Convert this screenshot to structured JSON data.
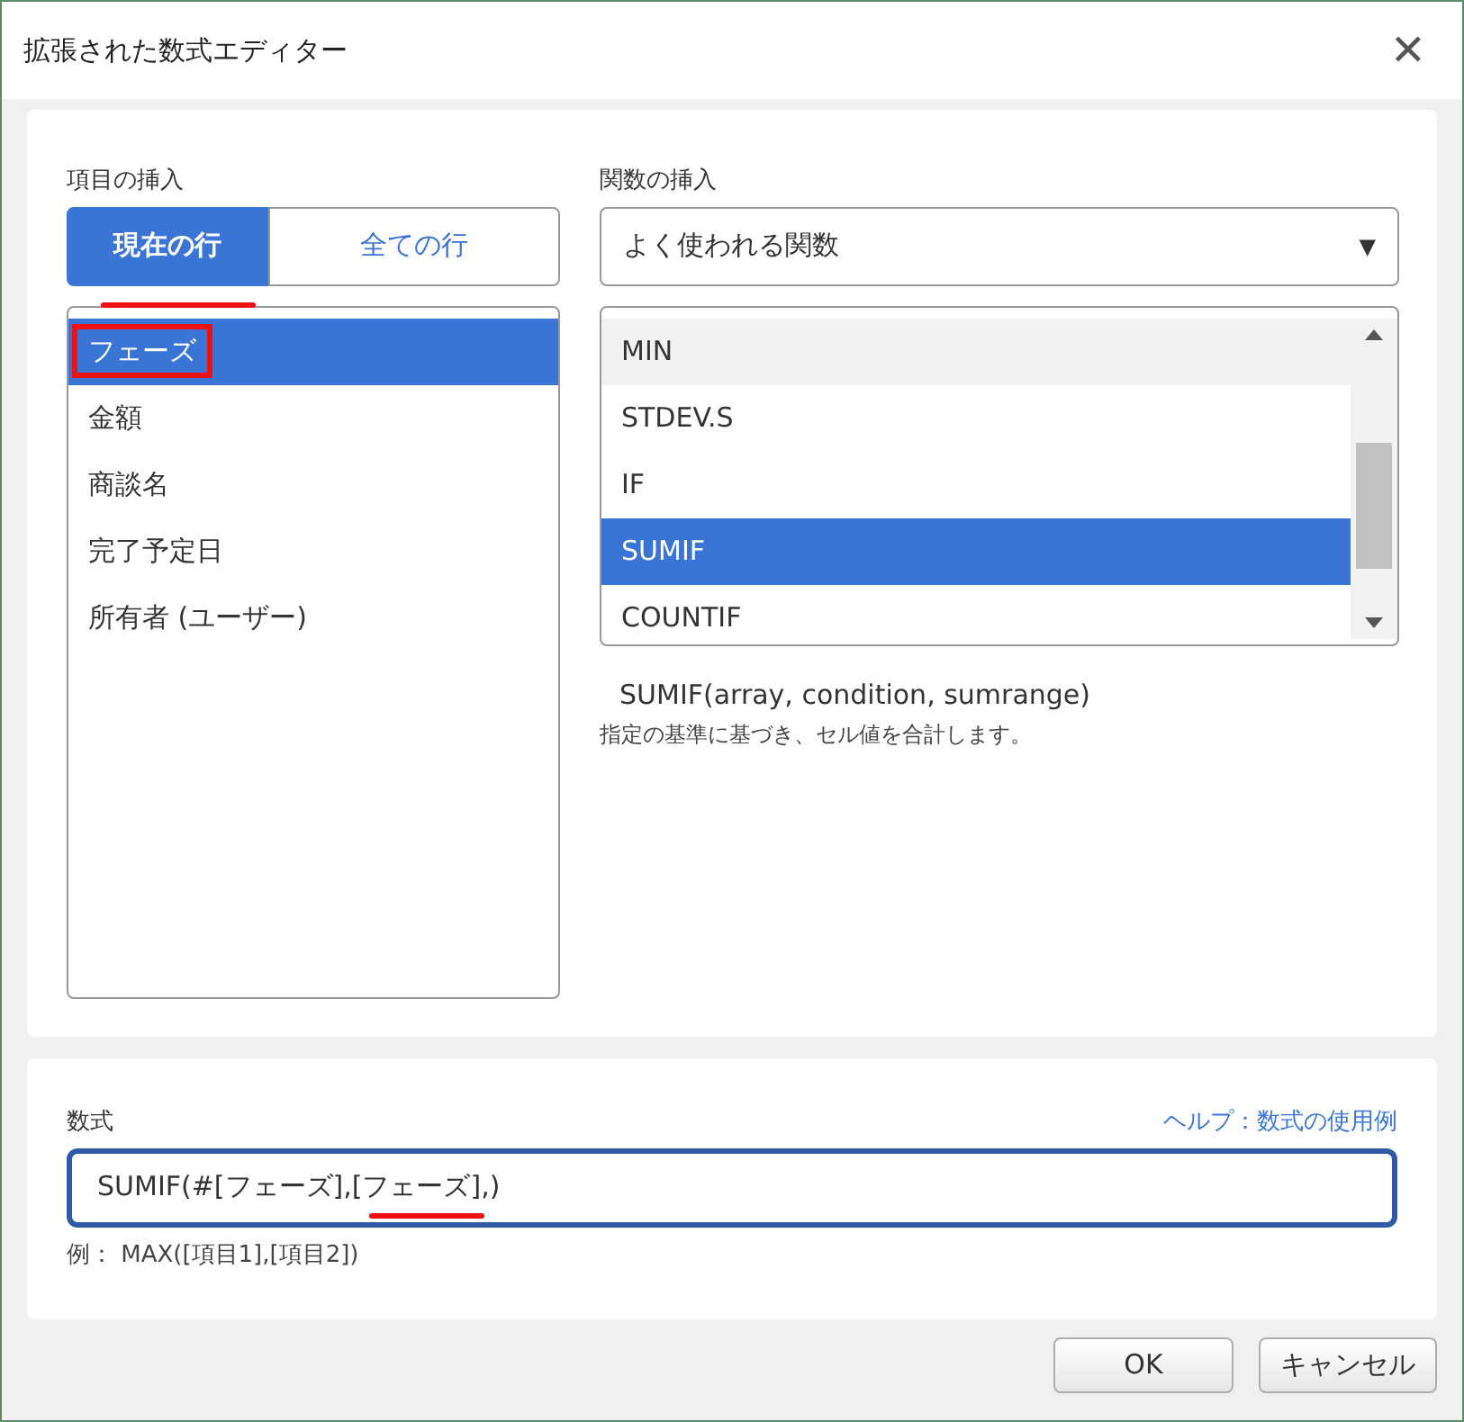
{
  "window": {
    "title": "拡張された数式エディター",
    "close": "✕"
  },
  "fields_section": {
    "label": "項目の挿入",
    "tabs": [
      {
        "label": "現在の行",
        "selected": true,
        "annotated": true
      },
      {
        "label": "全ての行",
        "selected": false,
        "annotated": false
      }
    ],
    "items": [
      {
        "label": "フェーズ",
        "selected": true,
        "annotated": true
      },
      {
        "label": "金額",
        "selected": false,
        "annotated": false
      },
      {
        "label": "商談名",
        "selected": false,
        "annotated": false
      },
      {
        "label": "完了予定日",
        "selected": false,
        "annotated": false
      },
      {
        "label": "所有者 (ユーザー)",
        "selected": false,
        "annotated": false
      }
    ]
  },
  "functions_section": {
    "label": "関数の挿入",
    "dropdown": {
      "value": "よく使われる関数",
      "arrow": "▼"
    },
    "items": [
      {
        "label": "MIN",
        "selected": false,
        "hovered": true
      },
      {
        "label": "STDEV.S",
        "selected": false,
        "hovered": false
      },
      {
        "label": "IF",
        "selected": false,
        "hovered": false
      },
      {
        "label": "SUMIF",
        "selected": true,
        "hovered": false
      },
      {
        "label": "COUNTIF",
        "selected": false,
        "hovered": false
      }
    ],
    "signature": "SUMIF(array, condition, sumrange)",
    "description": "指定の基準に基づき、セル値を合計します。"
  },
  "formula": {
    "label": "数式",
    "help_link": "ヘルプ：数式の使用例",
    "value": "SUMIF(#[フェーズ],[フェーズ],)",
    "annotated": true,
    "example": "例： MAX([項目1],[項目2])"
  },
  "buttons": [
    "OK",
    "キャンセル"
  ]
}
